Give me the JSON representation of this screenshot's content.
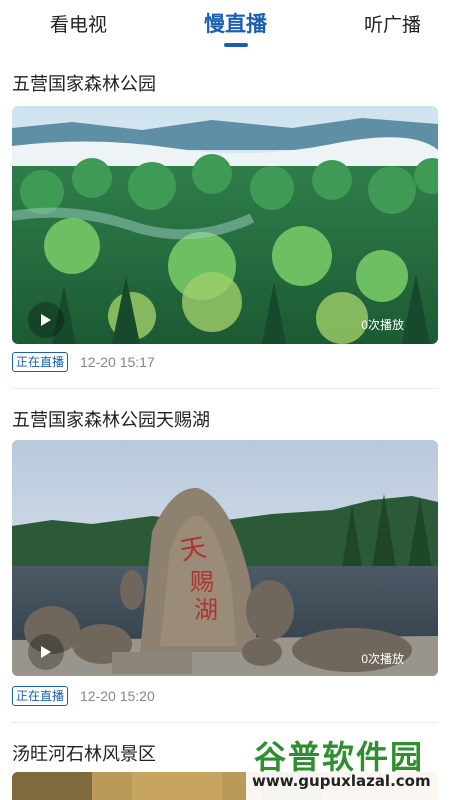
{
  "tabs": [
    {
      "label": "看电视"
    },
    {
      "label": "慢直播"
    },
    {
      "label": "听广播"
    }
  ],
  "active_tab": "慢直播",
  "accent_color": "#1a5fb4",
  "items": [
    {
      "title": "五营国家森林公园",
      "plays": "0次播放",
      "live_badge": "正在直播",
      "time": "12-20 15:17"
    },
    {
      "title": "五营国家森林公园天赐湖",
      "plays": "0次播放",
      "live_badge": "正在直播",
      "time": "12-20 15:20"
    },
    {
      "title": "汤旺河石林风景区"
    }
  ],
  "watermark": {
    "title": "谷普软件园",
    "url": "www.gupuxlazal.com"
  }
}
